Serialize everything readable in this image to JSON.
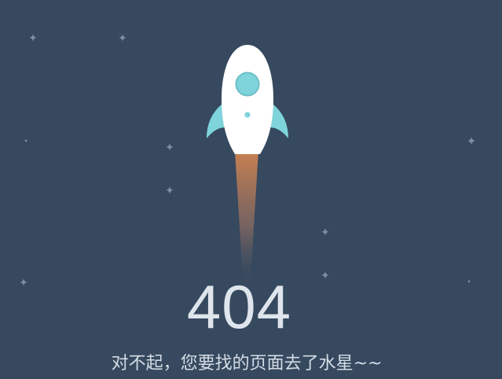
{
  "error": {
    "code": "404",
    "message": "对不起，您要找的页面去了水星~~"
  },
  "illustration": {
    "icon": "rocket-icon",
    "star_icon": "star-icon"
  },
  "colors": {
    "background": "#36495f",
    "rocket_body": "#ffffff",
    "rocket_accent": "#7fd3da",
    "flame": "#c27a4a",
    "text": "#dfe5ec",
    "star": "#7e8fa3"
  }
}
